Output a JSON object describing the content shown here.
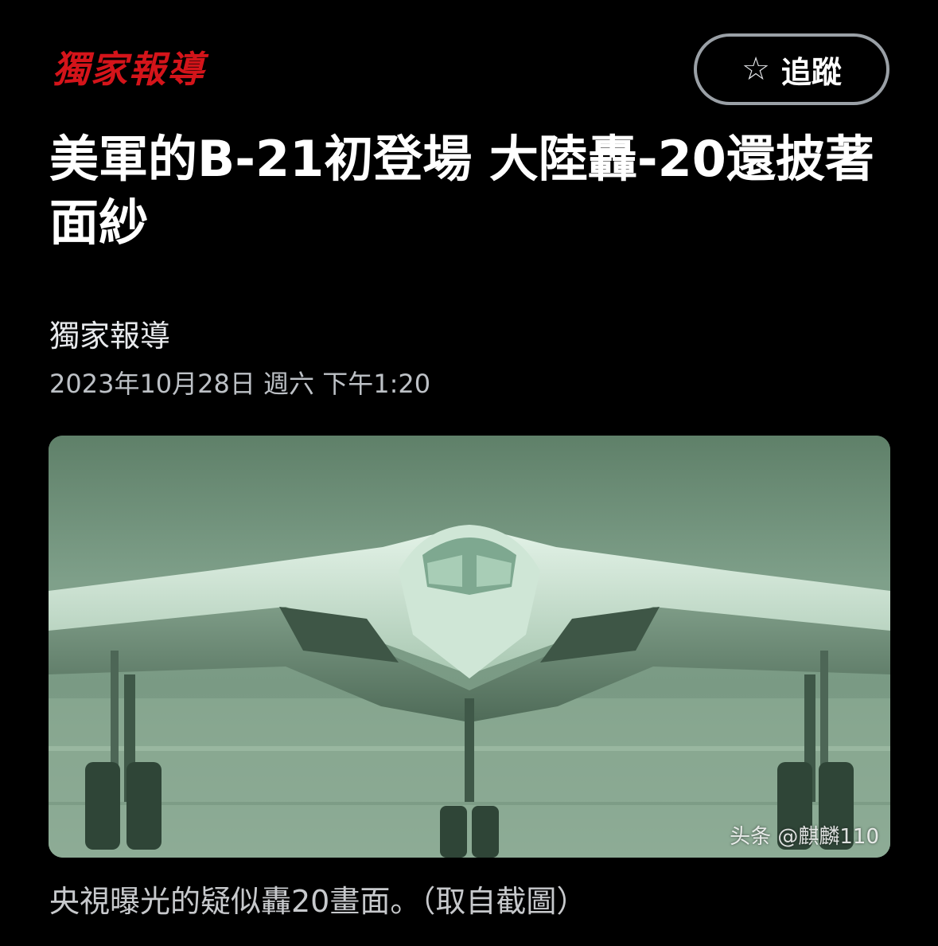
{
  "header": {
    "logo_text": "獨家報導",
    "follow_label": "追蹤",
    "follow_icon": "star-outline-icon"
  },
  "article": {
    "title": "美軍的B-21初登場 大陸轟-20還披著面紗",
    "source": "獨家報導",
    "timestamp": "2023年10月28日 週六 下午1:20",
    "image_watermark": "头条 @麒麟110",
    "image_caption": "央視曝光的疑似轟20畫面。（取自截圖）"
  },
  "colors": {
    "background": "#000000",
    "logo_red": "#d4141a",
    "button_border": "#9aa0a6"
  }
}
